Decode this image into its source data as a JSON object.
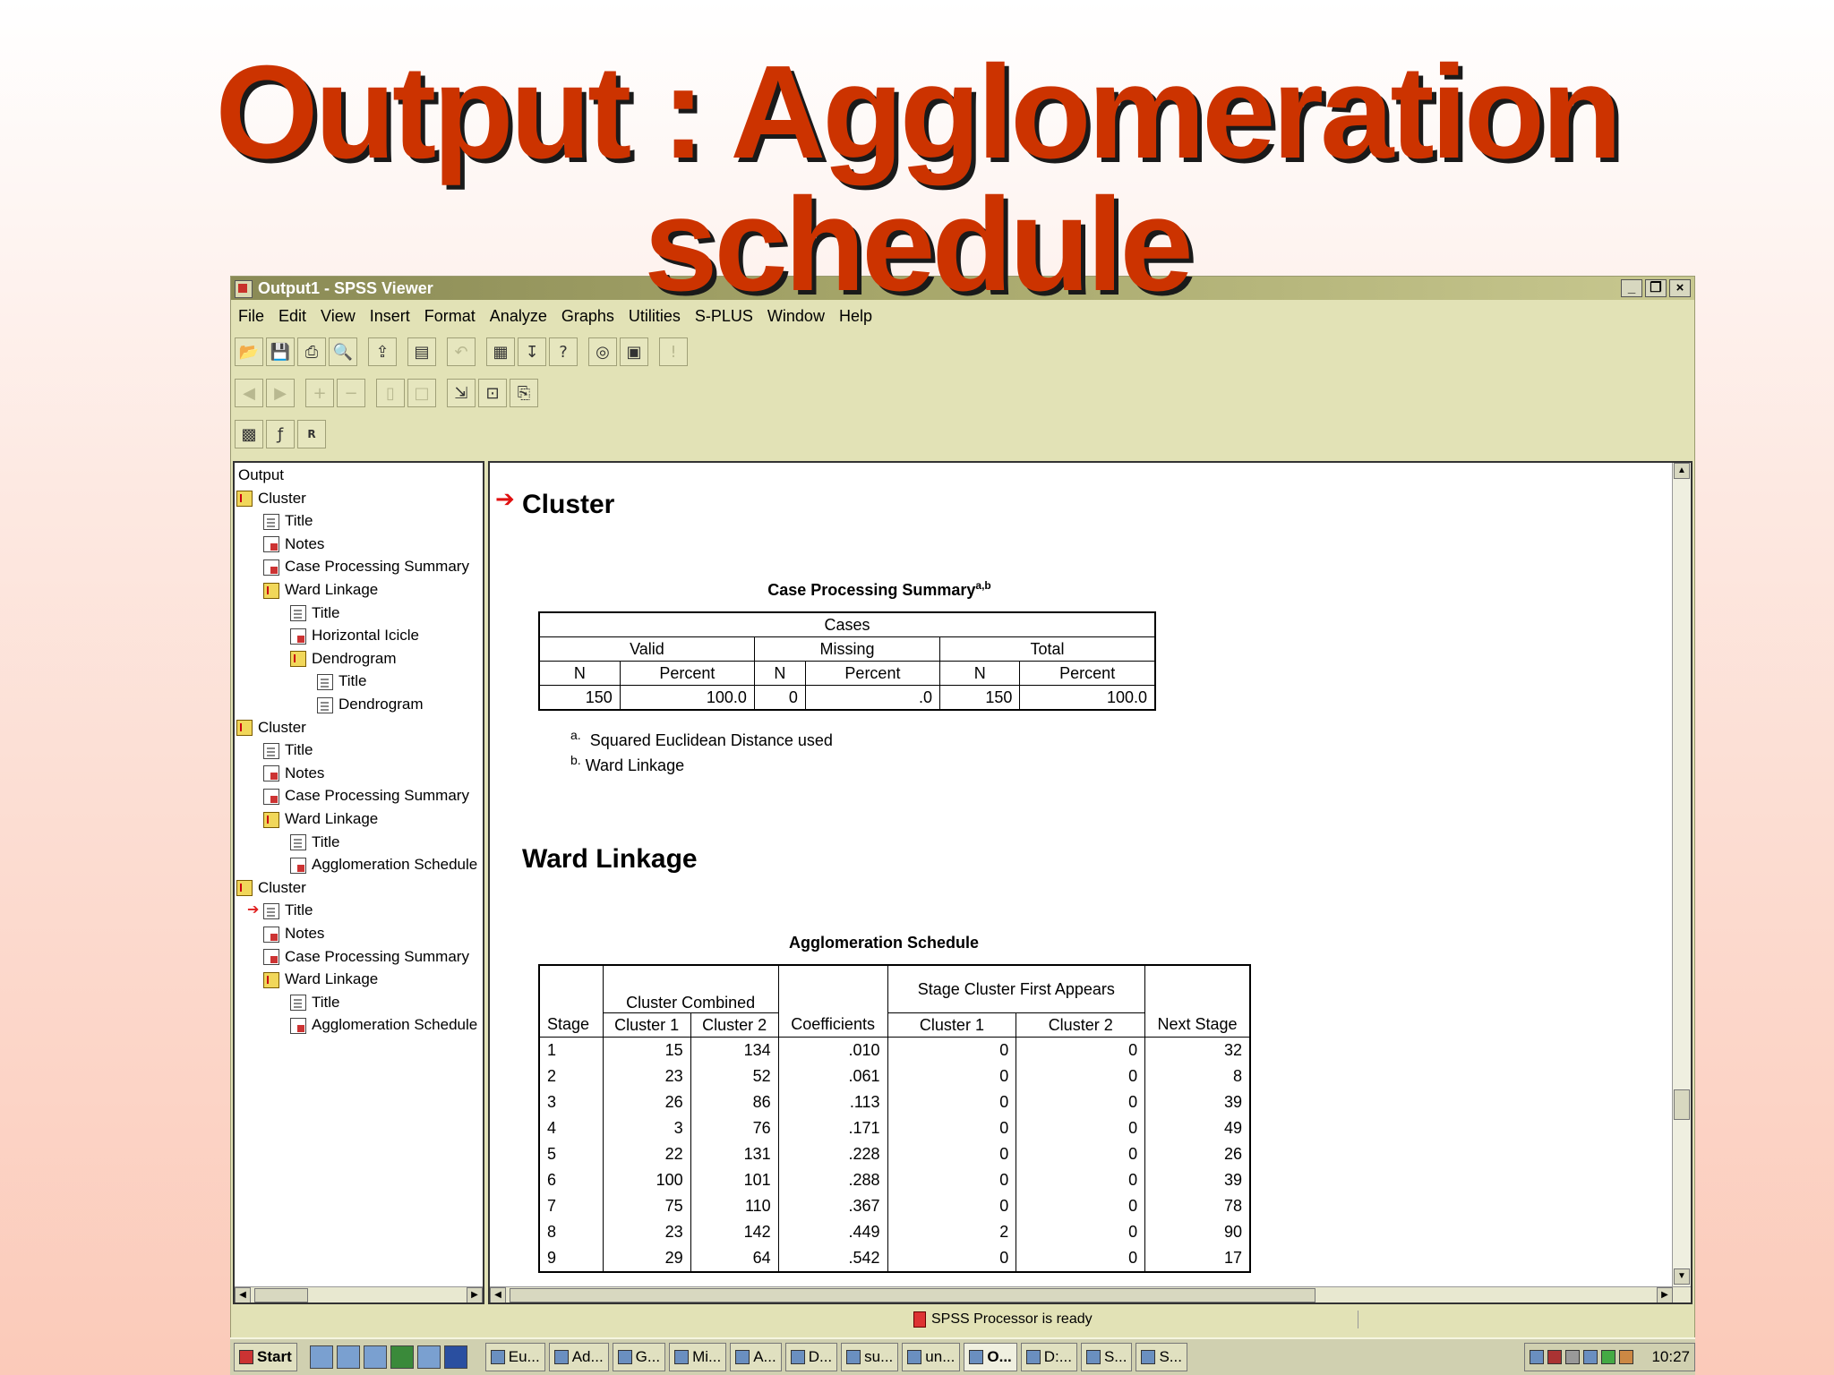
{
  "slide": {
    "title_line1": "Output :   Agglomeration",
    "title_line2": "schedule"
  },
  "window": {
    "title": "Output1 - SPSS Viewer",
    "menu": [
      "File",
      "Edit",
      "View",
      "Insert",
      "Format",
      "Analyze",
      "Graphs",
      "Utilities",
      "S-PLUS",
      "Window",
      "Help"
    ]
  },
  "tree": [
    {
      "label": "Output",
      "indent": 0,
      "icon": "none"
    },
    {
      "label": "Cluster",
      "indent": 1,
      "icon": "book"
    },
    {
      "label": "Title",
      "indent": 2,
      "icon": "doc"
    },
    {
      "label": "Notes",
      "indent": 2,
      "icon": "tbl"
    },
    {
      "label": "Case Processing Summary",
      "indent": 2,
      "icon": "tbl"
    },
    {
      "label": "Ward Linkage",
      "indent": 2,
      "icon": "book"
    },
    {
      "label": "Title",
      "indent": 3,
      "icon": "doc"
    },
    {
      "label": "Horizontal Icicle",
      "indent": 3,
      "icon": "tbl"
    },
    {
      "label": "Dendrogram",
      "indent": 3,
      "icon": "book"
    },
    {
      "label": "Title",
      "indent": 4,
      "icon": "doc"
    },
    {
      "label": "Dendrogram",
      "indent": 4,
      "icon": "doc"
    },
    {
      "label": "Cluster",
      "indent": 1,
      "icon": "book"
    },
    {
      "label": "Title",
      "indent": 2,
      "icon": "doc"
    },
    {
      "label": "Notes",
      "indent": 2,
      "icon": "tbl"
    },
    {
      "label": "Case Processing Summary",
      "indent": 2,
      "icon": "tbl"
    },
    {
      "label": "Ward Linkage",
      "indent": 2,
      "icon": "book"
    },
    {
      "label": "Title",
      "indent": 3,
      "icon": "doc"
    },
    {
      "label": "Agglomeration Schedule",
      "indent": 3,
      "icon": "tbl"
    },
    {
      "label": "Cluster",
      "indent": 1,
      "icon": "book"
    },
    {
      "label": "Title",
      "indent": 2,
      "icon": "doc",
      "pointer": true
    },
    {
      "label": "Notes",
      "indent": 2,
      "icon": "tbl"
    },
    {
      "label": "Case Processing Summary",
      "indent": 2,
      "icon": "tbl"
    },
    {
      "label": "Ward Linkage",
      "indent": 2,
      "icon": "book"
    },
    {
      "label": "Title",
      "indent": 3,
      "icon": "doc"
    },
    {
      "label": "Agglomeration Schedule",
      "indent": 3,
      "icon": "tbl"
    }
  ],
  "output": {
    "cluster_heading": "Cluster",
    "cps": {
      "title": "Case Processing Summary",
      "title_sup": "a,b",
      "cases_label": "Cases",
      "groups": [
        "Valid",
        "Missing",
        "Total"
      ],
      "subheads": [
        "N",
        "Percent",
        "N",
        "Percent",
        "N",
        "Percent"
      ],
      "values": [
        "150",
        "100.0",
        "0",
        ".0",
        "150",
        "100.0"
      ],
      "footnote_a_mark": "a.",
      "footnote_a": "Squared Euclidean Distance used",
      "footnote_b_mark": "b.",
      "footnote_b": "Ward Linkage"
    },
    "ward_heading": "Ward Linkage",
    "agg": {
      "title": "Agglomeration Schedule",
      "header_cluster_combined": "Cluster Combined",
      "header_stage_first": "Stage Cluster First Appears",
      "cols": [
        "Stage",
        "Cluster 1",
        "Cluster 2",
        "Coefficients",
        "Cluster 1",
        "Cluster 2",
        "Next Stage"
      ],
      "rows": [
        [
          "1",
          "15",
          "134",
          ".010",
          "0",
          "0",
          "32"
        ],
        [
          "2",
          "23",
          "52",
          ".061",
          "0",
          "0",
          "8"
        ],
        [
          "3",
          "26",
          "86",
          ".113",
          "0",
          "0",
          "39"
        ],
        [
          "4",
          "3",
          "76",
          ".171",
          "0",
          "0",
          "49"
        ],
        [
          "5",
          "22",
          "131",
          ".228",
          "0",
          "0",
          "26"
        ],
        [
          "6",
          "100",
          "101",
          ".288",
          "0",
          "0",
          "39"
        ],
        [
          "7",
          "75",
          "110",
          ".367",
          "0",
          "0",
          "78"
        ],
        [
          "8",
          "23",
          "142",
          ".449",
          "2",
          "0",
          "90"
        ],
        [
          "9",
          "29",
          "64",
          ".542",
          "0",
          "0",
          "17"
        ]
      ]
    }
  },
  "status": {
    "text": "SPSS Processor  is ready"
  },
  "taskbar": {
    "start": "Start",
    "buttons": [
      "Eu...",
      "Ad...",
      "G...",
      "Mi...",
      "A...",
      "D...",
      "su...",
      "un...",
      "O...",
      "D:...",
      "S...",
      "S..."
    ],
    "clock": "10:27"
  }
}
